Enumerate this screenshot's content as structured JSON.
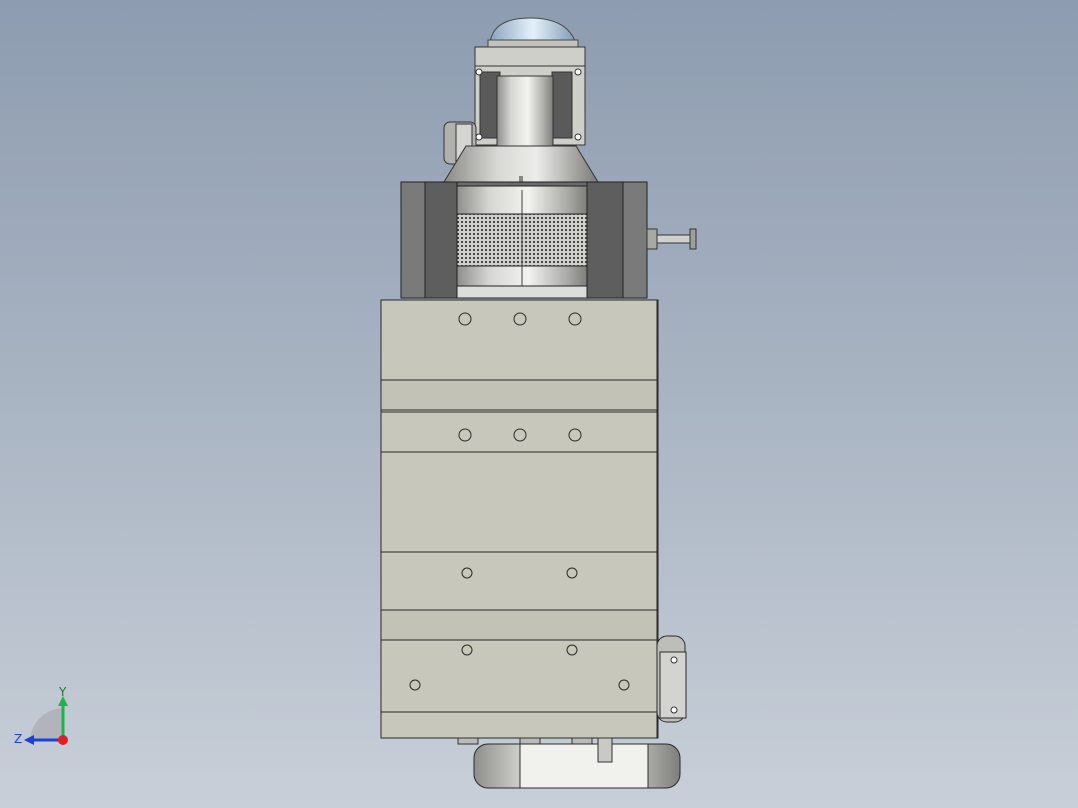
{
  "viewport": {
    "background_top": "#8d9cb0",
    "background_bottom": "#c8cfd8"
  },
  "model": {
    "body_color": "#c7c7bb",
    "metal_color": "#b9b9b4",
    "dark_color": "#5e5e5e",
    "fan_color": "#b8d4ec"
  },
  "triad": {
    "y_label": "Y",
    "z_label": "Z",
    "y_color": "#22b14c",
    "z_color": "#1c3fd6",
    "x_color": "#e0201f"
  }
}
